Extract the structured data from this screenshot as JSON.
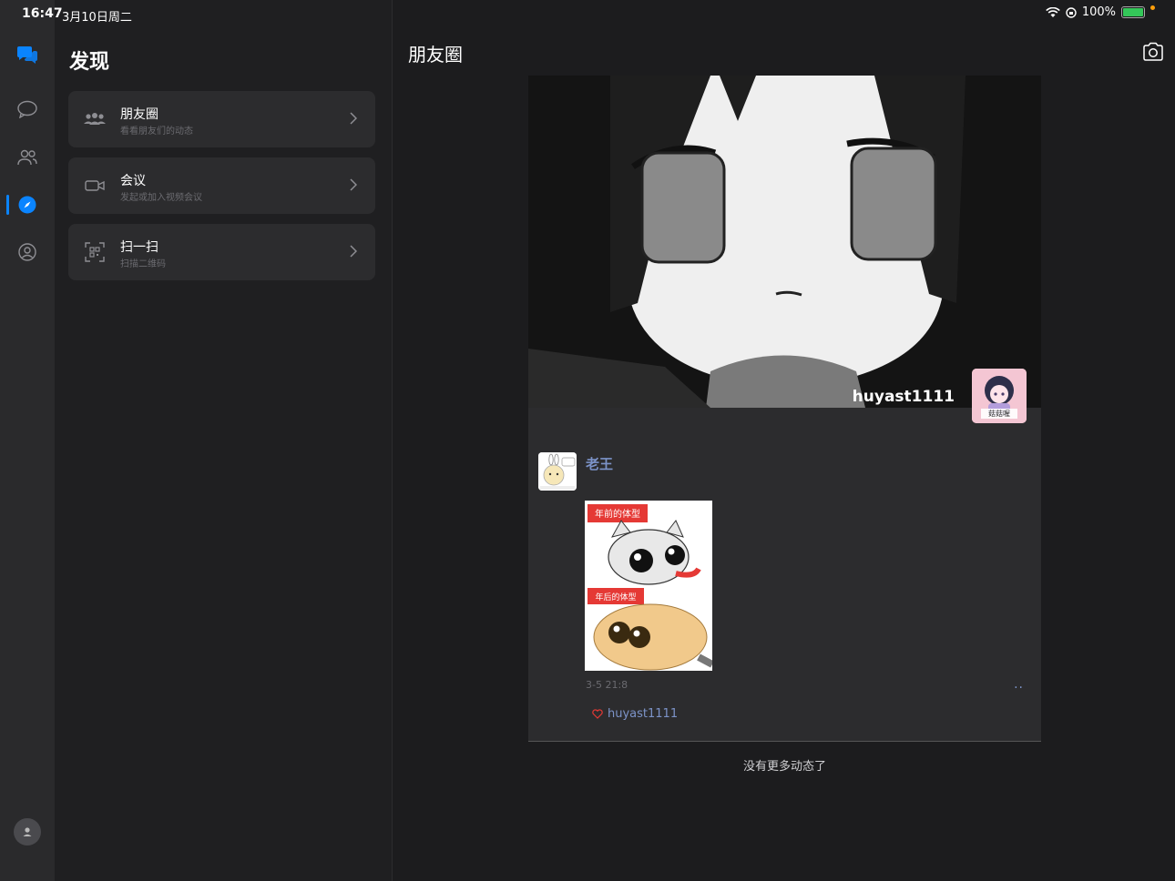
{
  "status_bar": {
    "time": "16:47",
    "date": "3月10日周二",
    "battery": "100%"
  },
  "rail": {
    "items": [
      "chats-icon",
      "messages-icon",
      "contacts-icon",
      "discover-icon",
      "profile-icon"
    ],
    "active": "discover-icon",
    "accent": "#0a84ff"
  },
  "discover": {
    "title": "发现",
    "items": [
      {
        "label": "朋友圈",
        "sub": "看看朋友们的动态",
        "icon": "group-icon"
      },
      {
        "label": "会议",
        "sub": "发起或加入视频会议",
        "icon": "video-icon"
      },
      {
        "label": "扫一扫",
        "sub": "扫描二维码",
        "icon": "scan-icon"
      }
    ]
  },
  "moments": {
    "title": "朋友圈",
    "cover_username": "huyast1111",
    "cover_avatar_text": "菇菇喔",
    "post": {
      "author": "老王",
      "image_caption_top": "年前的体型",
      "image_caption_bottom": "年后的体型",
      "time": "3-5 21:8",
      "more": "··",
      "liked_by": "huyast1111"
    },
    "end_text": "没有更多动态了"
  }
}
